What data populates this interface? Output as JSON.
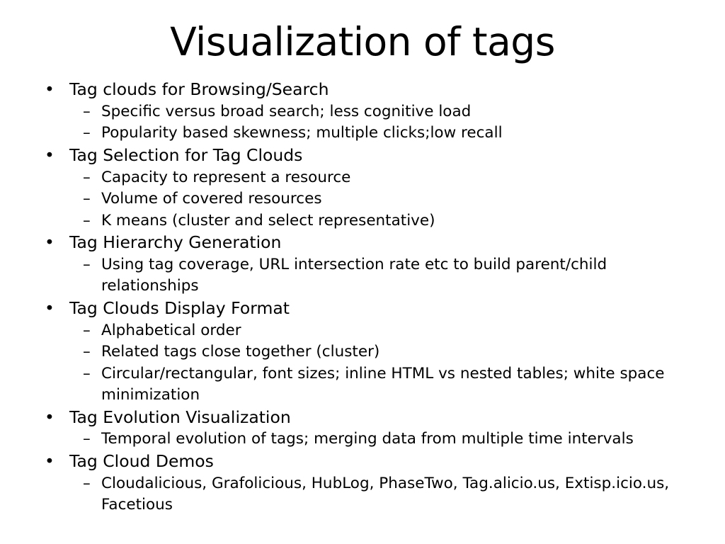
{
  "slide": {
    "title": "Visualization of tags",
    "background_color": "#ffffff",
    "text_color": "#000000",
    "bullet_marker_level1": "•",
    "bullet_marker_level2": "–",
    "items": [
      {
        "level": 1,
        "text": "Tag clouds for Browsing/Search"
      },
      {
        "level": 2,
        "text": "Specific versus broad search; less cognitive load"
      },
      {
        "level": 2,
        "text": "Popularity based skewness; multiple clicks;low recall"
      },
      {
        "level": 1,
        "text": "Tag Selection for Tag Clouds"
      },
      {
        "level": 2,
        "text": "Capacity to represent a resource"
      },
      {
        "level": 2,
        "text": "Volume of covered resources"
      },
      {
        "level": 2,
        "text": "K means (cluster and select representative)"
      },
      {
        "level": 1,
        "text": "Tag Hierarchy Generation"
      },
      {
        "level": 2,
        "text": "Using tag coverage, URL intersection rate etc to build parent/child relationships"
      },
      {
        "level": 1,
        "text": "Tag Clouds Display Format"
      },
      {
        "level": 2,
        "text": "Alphabetical order"
      },
      {
        "level": 2,
        "text": "Related tags close together (cluster)"
      },
      {
        "level": 2,
        "text": "Circular/rectangular, font sizes; inline HTML vs nested tables; white space minimization"
      },
      {
        "level": 1,
        "text": "Tag Evolution Visualization"
      },
      {
        "level": 2,
        "text": "Temporal evolution of tags; merging data from multiple time intervals"
      },
      {
        "level": 1,
        "text": "Tag Cloud Demos"
      },
      {
        "level": 2,
        "text": "Cloudalicious, Grafolicious, HubLog, PhaseTwo, Tag.alicio.us, Extisp.icio.us, Facetious"
      }
    ]
  }
}
